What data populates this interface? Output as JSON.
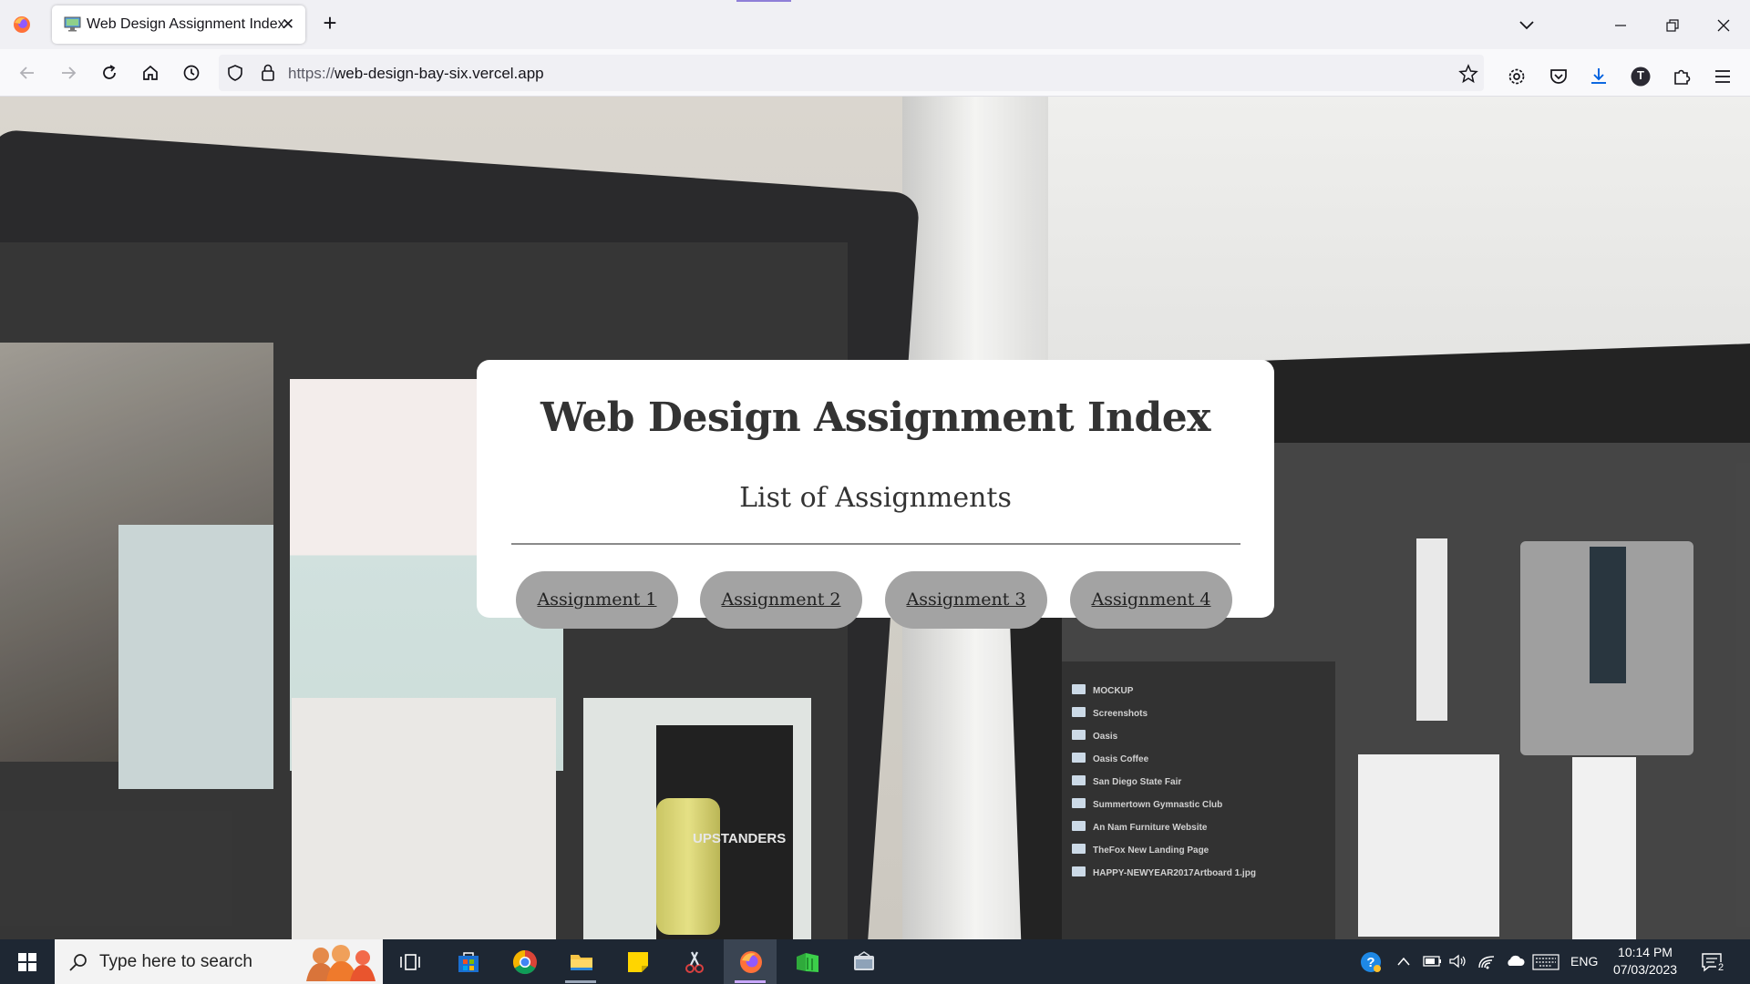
{
  "browser": {
    "tab_title": "Web Design Assignment Index",
    "url_scheme": "https://",
    "url_host": "web-design-bay-six.vercel.app",
    "profile_initial": "T"
  },
  "page": {
    "heading": "Web Design Assignment Index",
    "subheading": "List of Assignments",
    "buttons": [
      {
        "label": "Assignment 1"
      },
      {
        "label": "Assignment 2"
      },
      {
        "label": "Assignment 3"
      },
      {
        "label": "Assignment 4"
      }
    ]
  },
  "background_photo": {
    "text": "UPSTANDERS",
    "folders": [
      "MOCKUP",
      "Screenshots",
      "Oasis",
      "Oasis Coffee",
      "San Diego State Fair",
      "Summertown Gymnastic Club",
      "An Nam Furniture Website",
      "TheFox New Landing Page",
      "HAPPY-NEWYEAR2017Artboard 1.jpg"
    ]
  },
  "taskbar": {
    "search_placeholder": "Type here to search",
    "language": "ENG",
    "time": "10:14 PM",
    "date": "07/03/2023",
    "notification_count": "2"
  }
}
